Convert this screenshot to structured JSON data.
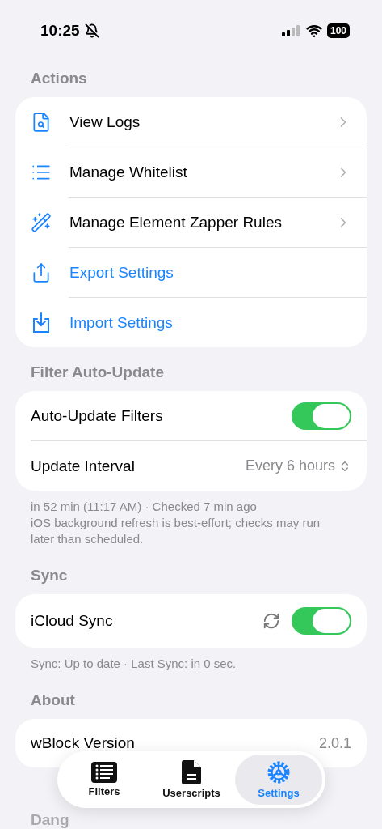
{
  "status_bar": {
    "time": "10:25",
    "battery": "100"
  },
  "sections": [
    {
      "header": "Actions",
      "rows": [
        {
          "kind": "link",
          "label": "View Logs"
        },
        {
          "kind": "link",
          "label": "Manage Whitelist"
        },
        {
          "kind": "link",
          "label": "Manage Element Zapper Rules"
        },
        {
          "kind": "action",
          "label": "Export Settings"
        },
        {
          "kind": "action",
          "label": "Import Settings"
        }
      ]
    },
    {
      "header": "Filter Auto-Update",
      "rows": [
        {
          "kind": "toggle",
          "label": "Auto-Update Filters",
          "on": true
        },
        {
          "kind": "picker",
          "label": "Update Interval",
          "value": "Every 6 hours"
        }
      ],
      "footer": [
        "in 52 min (11:17 AM) · Checked 7 min ago",
        "iOS background refresh is best-effort; checks may run later than scheduled."
      ]
    },
    {
      "header": "Sync",
      "rows": [
        {
          "kind": "sync_toggle",
          "label": "iCloud Sync",
          "on": true
        }
      ],
      "footer": [
        "Sync: Up to date · Last Sync: in 0 sec."
      ]
    },
    {
      "header": "About",
      "rows": [
        {
          "kind": "info",
          "label": "wBlock Version",
          "value": "2.0.1"
        }
      ]
    },
    {
      "header": "Dang"
    }
  ],
  "tab_bar": [
    {
      "label": "Filters",
      "selected": false
    },
    {
      "label": "Userscripts",
      "selected": false
    },
    {
      "label": "Settings",
      "selected": true
    }
  ]
}
